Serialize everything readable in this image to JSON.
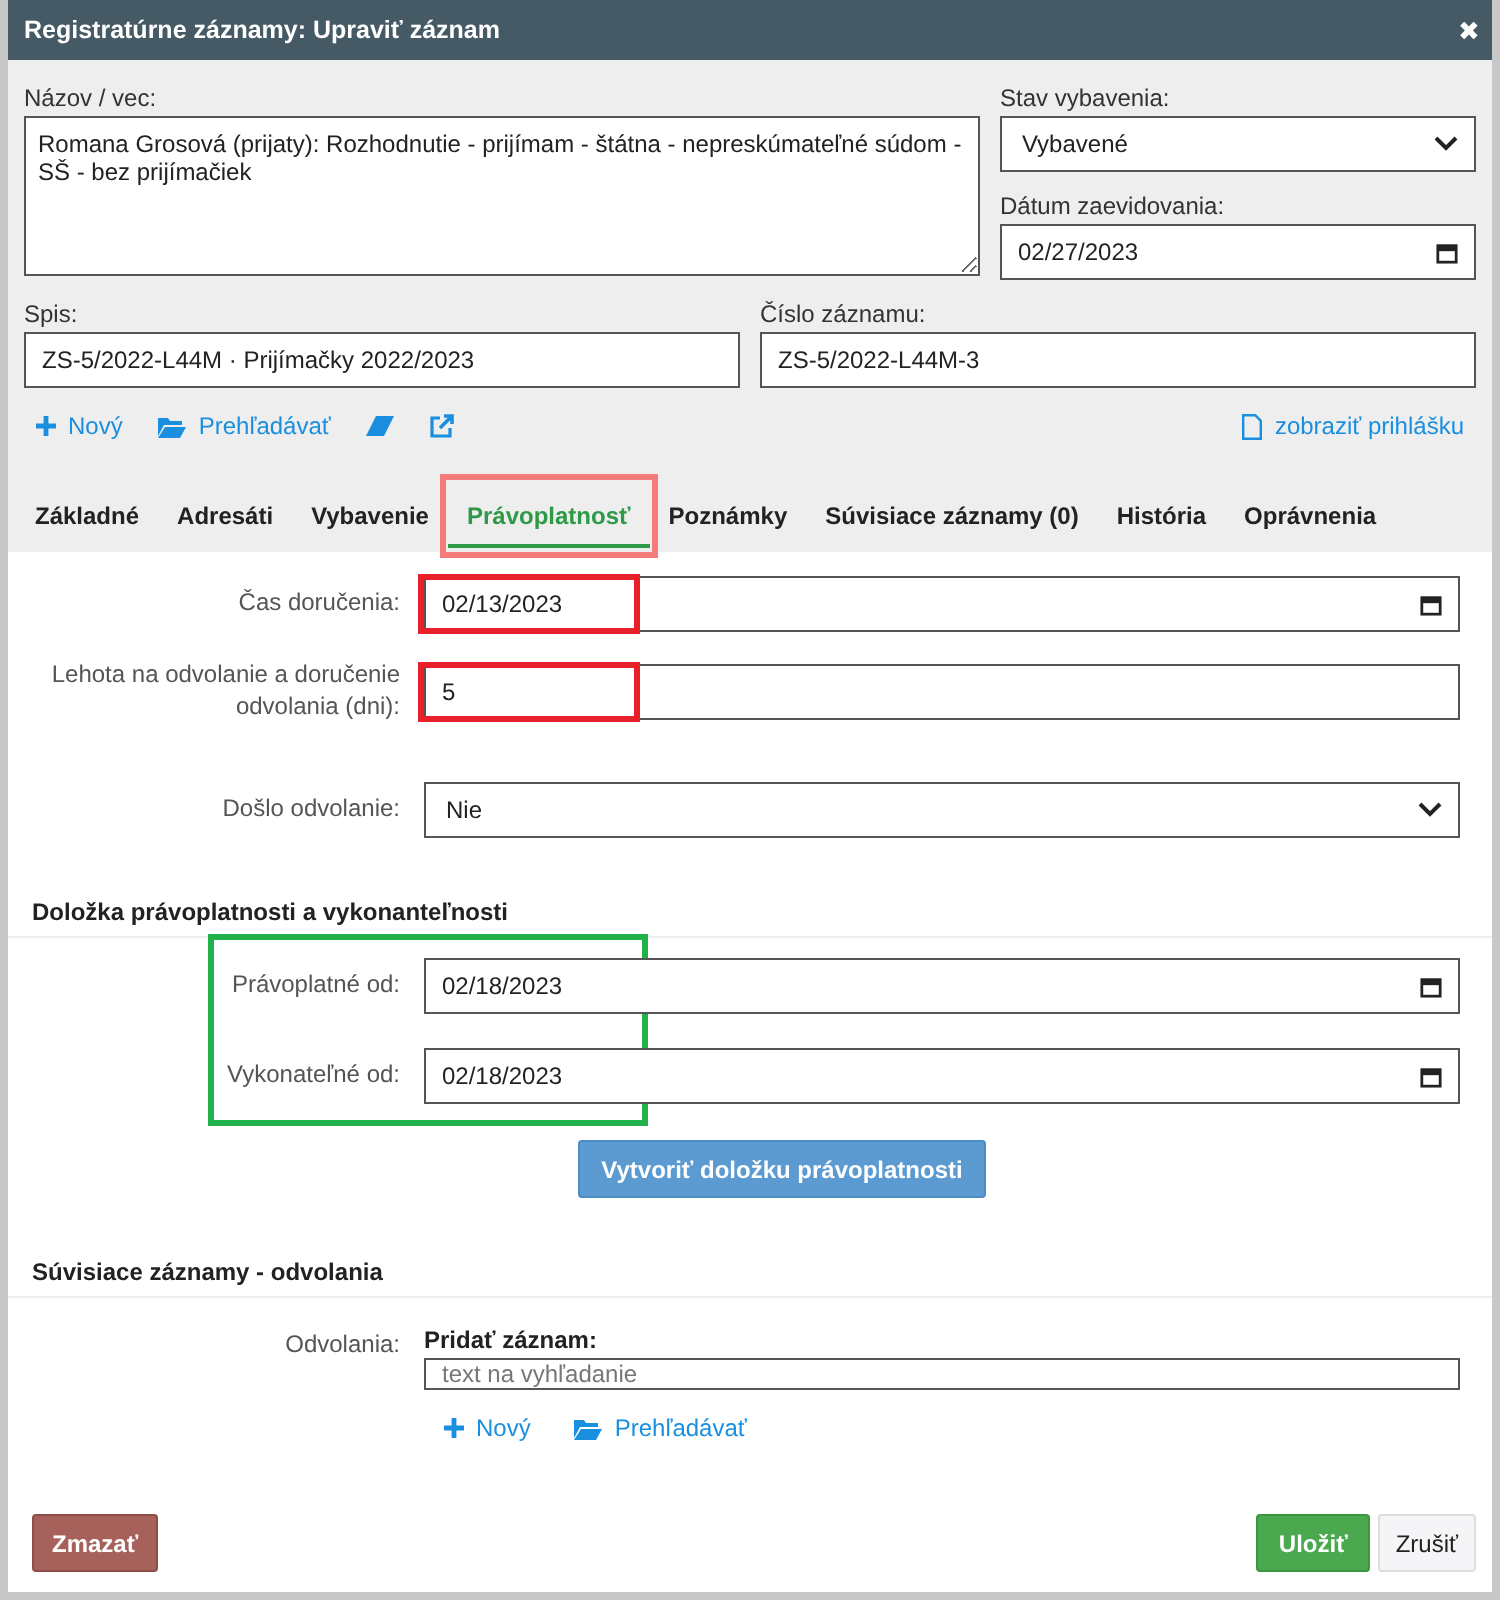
{
  "window": {
    "title": "Registratúrne záznamy: Upraviť záznam",
    "close": "✖"
  },
  "header": {
    "name_label": "Názov / vec:",
    "name_value": "Romana Grosová (prijaty): Rozhodnutie - prijímam - štátna - nepreskúmateľné súdom - SŠ - bez prijímačiek",
    "status_label": "Stav vybavenia:",
    "status_value": "Vybavené",
    "date_label": "Dátum zaevidovania:",
    "date_value": "02/27/2023",
    "file_label": "Spis:",
    "file_value": "ZS-5/2022-L44M · Prijímačky 2022/2023",
    "number_label": "Číslo záznamu:",
    "number_value": "ZS-5/2022-L44M-3",
    "new_link": "Nový",
    "browse_link": "Prehľadávať",
    "show_link": "zobraziť prihlášku"
  },
  "tabs": [
    {
      "label": "Základné",
      "selected": false
    },
    {
      "label": "Adresáti",
      "selected": false
    },
    {
      "label": "Vybavenie",
      "selected": false
    },
    {
      "label": "Právoplatnosť",
      "selected": true,
      "highlighted": true
    },
    {
      "label": "Poznámky",
      "selected": false
    },
    {
      "label": "Súvisiace záznamy (0)",
      "selected": false
    },
    {
      "label": "História",
      "selected": false
    },
    {
      "label": "Oprávnenia",
      "selected": false
    }
  ],
  "fields": [
    {
      "kind": "date",
      "label": "Čas doručenia:",
      "value": "02/13/2023",
      "highlighted": true
    },
    {
      "kind": "text",
      "label": "Lehota na odvolanie a doručenie odvolania (dni):",
      "value": "5",
      "highlighted": true
    },
    {
      "kind": "select",
      "label": "Došlo odvolanie:",
      "value": "Nie",
      "highlighted": false
    }
  ],
  "clause": {
    "title": "Doložka právoplatnosti a vykonanteľnosti",
    "highlighted": true,
    "fields": [
      {
        "label": "Právoplatné od:",
        "value": "02/18/2023"
      },
      {
        "label": "Vykonateľné od:",
        "value": "02/18/2023"
      }
    ],
    "button": "Vytvoriť doložku právoplatnosti"
  },
  "appeals": {
    "title": "Súvisiace záznamy - odvolania",
    "label": "Odvolania:",
    "add_label": "Pridať záznam:",
    "placeholder": "text na vyhľadanie",
    "new_link": "Nový",
    "browse_link": "Prehľadávať"
  },
  "buttons": {
    "delete": "Zmazať",
    "save": "Uložiť",
    "cancel": "Zrušiť"
  }
}
